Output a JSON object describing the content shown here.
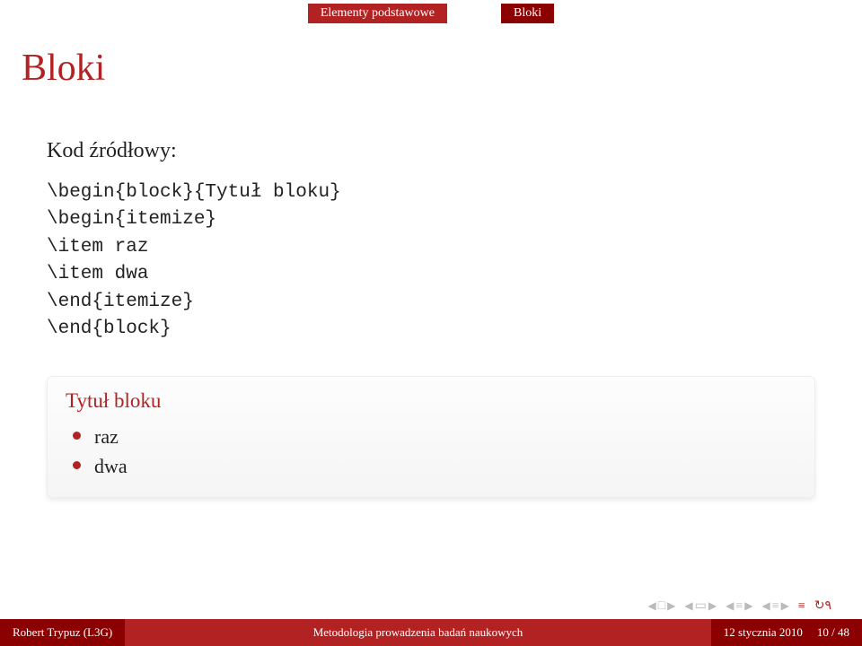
{
  "nav": {
    "section": "Elementy podstawowe",
    "subsection": "Bloki"
  },
  "title": "Bloki",
  "heading": "Kod źródłowy:",
  "code": "\\begin{block}{Tytuł bloku}\n\\begin{itemize}\n\\item raz\n\\item dwa\n\\end{itemize}\n\\end{block}",
  "block": {
    "title": "Tytuł bloku",
    "items": [
      "raz",
      "dwa"
    ]
  },
  "footer": {
    "author": "Robert Trypuz (L3G)",
    "talk": "Metodologia prowadzenia badań naukowych",
    "date": "12 stycznia 2010",
    "page": "10 / 48"
  }
}
